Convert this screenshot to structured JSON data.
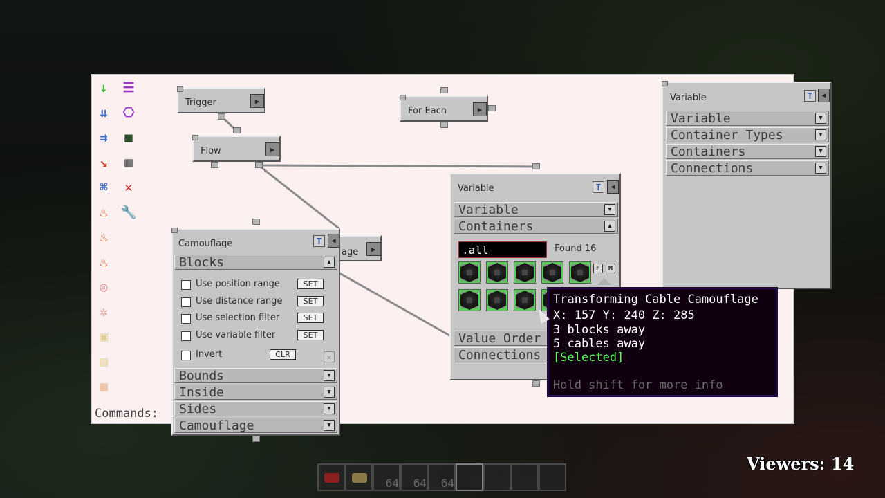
{
  "menu_icons": [
    {
      "icon": "green-arrow-down-icon",
      "glyph": "↓",
      "color": "#2fb82f",
      "dim": false
    },
    {
      "icon": "purple-list-icon",
      "glyph": "☰",
      "color": "#9a3ac8",
      "dim": false
    },
    {
      "icon": "blue-input-icon",
      "glyph": "⇊",
      "color": "#3a6ec8",
      "dim": false
    },
    {
      "icon": "purple-gear-box-icon",
      "glyph": "⎔",
      "color": "#9a3ac8",
      "dim": false
    },
    {
      "icon": "blue-output-icon",
      "glyph": "⇉",
      "color": "#3a6ec8",
      "dim": false
    },
    {
      "icon": "dark-green-square-icon",
      "glyph": "■",
      "color": "#2a4a2a",
      "dim": false
    },
    {
      "icon": "red-green-redstone-icon",
      "glyph": "↘",
      "color": "#c83a2a",
      "dim": false
    },
    {
      "icon": "gray-pattern-icon",
      "glyph": "▦",
      "color": "#4a4a4a",
      "dim": false
    },
    {
      "icon": "blue-network-icon",
      "glyph": "⌘",
      "color": "#3a6ec8",
      "dim": false
    },
    {
      "icon": "red-x-icon",
      "glyph": "✕",
      "color": "#d02a2a",
      "dim": false
    },
    {
      "icon": "fire-machine-icon",
      "glyph": "♨",
      "color": "#d05a1a",
      "dim": false
    },
    {
      "icon": "wrench-icon",
      "glyph": "🔧",
      "color": "#555555",
      "dim": false
    },
    {
      "icon": "fire-machine-2-icon",
      "glyph": "♨",
      "color": "#d05a1a",
      "dim": false
    },
    {
      "icon": "green-fire-icon",
      "glyph": "♨",
      "color": "#c84a1a",
      "dim": false
    },
    {
      "icon": "red-target-icon",
      "glyph": "◎",
      "color": "#c83a3a",
      "dim": true
    },
    {
      "icon": "red-pattern-icon",
      "glyph": "✲",
      "color": "#c83a3a",
      "dim": true
    },
    {
      "icon": "yellow-frame-icon",
      "glyph": "▣",
      "color": "#c8a830",
      "dim": true
    },
    {
      "icon": "yellow-page-icon",
      "glyph": "▤",
      "color": "#c8a830",
      "dim": true
    },
    {
      "icon": "orange-grid-icon",
      "glyph": "▦",
      "color": "#d07a2a",
      "dim": true
    }
  ],
  "commands_label": "Commands:",
  "nodes": {
    "trigger": "Trigger",
    "flow": "Flow",
    "for_each": "For Each",
    "hidden_node_suffix": "age"
  },
  "play_glyph": "▶",
  "camouflage_panel": {
    "title": "Camouflage",
    "t_label": "T",
    "close_glyph": "◀",
    "blocks_label": "Blocks",
    "options": [
      {
        "label": "Use position range",
        "button": "SET"
      },
      {
        "label": "Use distance range",
        "button": "SET"
      },
      {
        "label": "Use selection filter",
        "button": "SET"
      },
      {
        "label": "Use variable filter",
        "button": "SET"
      }
    ],
    "invert_label": "Invert",
    "clear_button": "CLR",
    "x_glyph": "✕",
    "sections": [
      "Bounds",
      "Inside",
      "Sides",
      "Camouflage"
    ]
  },
  "variable_panel_center": {
    "title": "Variable",
    "t_label": "T",
    "close_glyph": "◀",
    "menu_items": [
      "Variable",
      "Containers"
    ],
    "search_value": ".all",
    "found_text": "Found 16",
    "f_label": "F",
    "m_label": "M",
    "bottom_items": [
      "Value Order",
      "Connections"
    ]
  },
  "variable_panel_right": {
    "title": "Variable",
    "t_label": "T",
    "close_glyph": "◀",
    "menu_items": [
      "Variable",
      "Container Types",
      "Containers",
      "Connections"
    ]
  },
  "arrow_down_glyph": "▼",
  "arrow_up_glyph": "▲",
  "tooltip": {
    "title": "Transforming Cable Camouflage",
    "coords": "X: 157 Y: 240 Z: 285",
    "blocks_away": "3 blocks away",
    "cables_away": "5 cables away",
    "selected": "[Selected]",
    "hint": "Hold shift for more info"
  },
  "viewers_text": "Viewers: 14",
  "hotbar_counts": [
    "64",
    "64",
    "64"
  ],
  "colors": {
    "tooltip_title": "#ffffff",
    "tooltip_selected": "#55ff55",
    "tooltip_hint": "#6a6a6a"
  }
}
